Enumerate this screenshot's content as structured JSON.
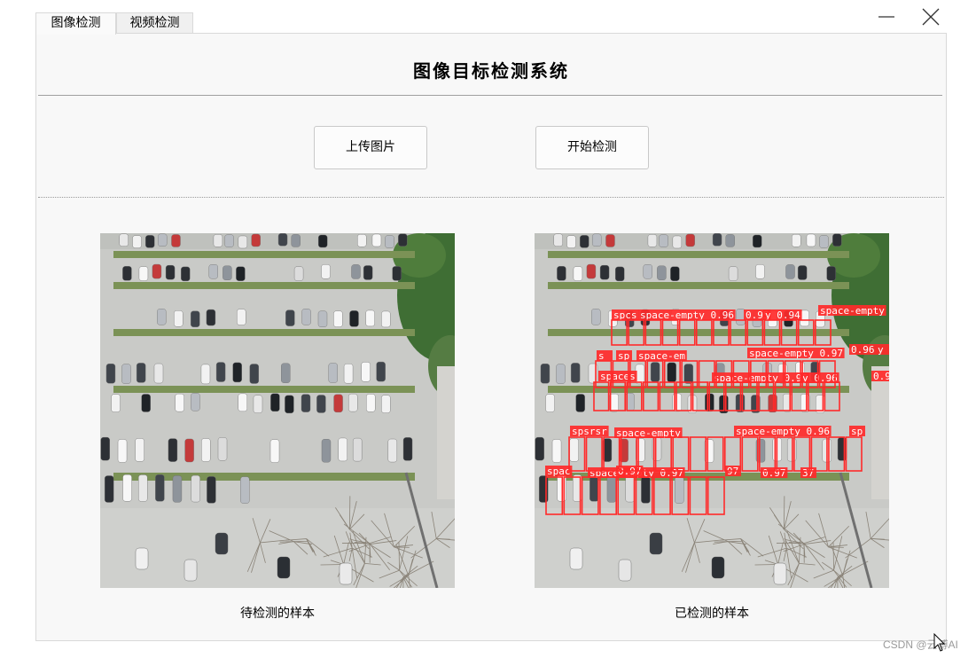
{
  "tabs": [
    {
      "label": "图像检测",
      "active": true
    },
    {
      "label": "视频检测",
      "active": false
    }
  ],
  "window_controls": {
    "minimize_icon": "minimize-icon",
    "close_icon": "close-icon"
  },
  "main": {
    "title": "图像目标检测系统",
    "upload_button": "上传图片",
    "detect_button": "开始检测",
    "original_caption": "待检测的样本",
    "detected_caption": "已检测的样本"
  },
  "detections": {
    "box_color": "#ff2a2a",
    "labels": [
      "spcs",
      "space-empty 0.96",
      "0.95",
      "y 0.94",
      "space-empty",
      "s",
      "sp",
      "space-em",
      "space-empty 0.97",
      "0.96",
      "y",
      "spaces",
      "space-empty 0.96",
      "y 0.96",
      "0.9",
      "spsrsr",
      "space-empty",
      "space-empty 0.96",
      "sp",
      "spac",
      "space-empty 0.97",
      "0.97",
      "97",
      "0.97",
      "37"
    ]
  },
  "watermark": "CSDN @云博AI"
}
